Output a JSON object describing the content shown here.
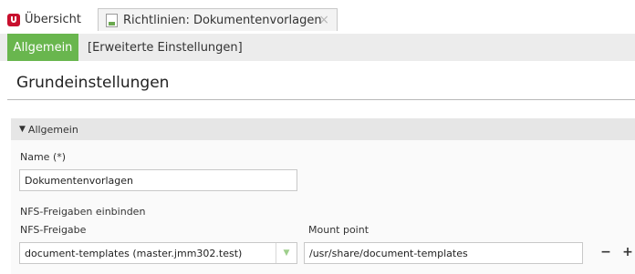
{
  "tabs": [
    {
      "label": "Übersicht"
    },
    {
      "label": "Richtlinien: Dokumentenvorlagen",
      "close_icon": "×"
    }
  ],
  "subtabs": [
    {
      "label": "Allgemein"
    },
    {
      "label": "[Erweiterte Einstellungen]"
    }
  ],
  "page_title": "Grundeinstellungen",
  "section": {
    "header": "Allgemein",
    "name_label": "Name (*)",
    "name_value": "Dokumentenvorlagen",
    "nfs_heading": "NFS-Freigaben einbinden",
    "nfs_share_label": "NFS-Freigabe",
    "nfs_share_value": "document-templates (master.jmm302.test)",
    "mount_label": "Mount point",
    "mount_value": "/usr/share/document-templates",
    "remove_symbol": "−",
    "add_symbol": "+"
  },
  "colors": {
    "accent": "#69b64e",
    "brand": "#c8102e"
  }
}
